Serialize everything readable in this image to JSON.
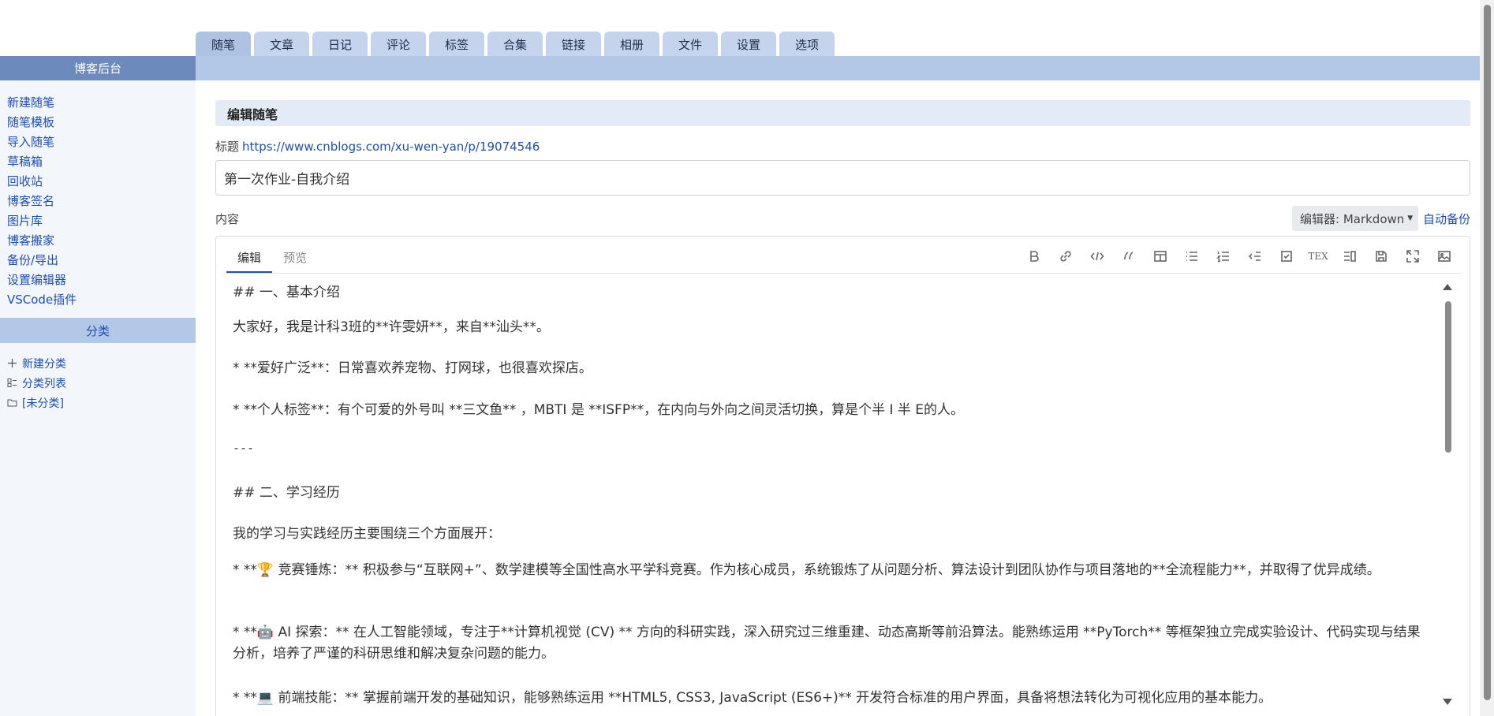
{
  "top_tabs": [
    "随笔",
    "文章",
    "日记",
    "评论",
    "标签",
    "合集",
    "链接",
    "相册",
    "文件",
    "设置",
    "选项"
  ],
  "sidebar": {
    "header": "博客后台",
    "links": [
      "新建随笔",
      "随笔模板",
      "导入随笔",
      "草稿箱",
      "回收站",
      "博客签名",
      "图片库",
      "博客搬家",
      "备份/导出",
      "设置编辑器",
      "VSCode插件"
    ],
    "category_header": "分类",
    "category_links": [
      {
        "icon": "plus-icon",
        "label": "新建分类"
      },
      {
        "icon": "list-icon",
        "label": "分类列表"
      },
      {
        "icon": "folder-icon",
        "label": "[未分类]"
      }
    ]
  },
  "main": {
    "section_title": "编辑随笔",
    "title_label": "标题",
    "title_link": "https://www.cnblogs.com/xu-wen-yan/p/19074546",
    "title_value": "第一次作业-自我介绍",
    "content_label": "内容",
    "editor_select": "编辑器: Markdown",
    "autosave": "自动备份"
  },
  "editor": {
    "tabs": [
      "编辑",
      "预览"
    ],
    "toolbar": [
      "bold-icon",
      "link-icon",
      "code-icon",
      "quote-icon",
      "table-icon",
      "bullet-list-icon",
      "numbered-list-icon",
      "outdent-icon",
      "checkbox-icon",
      "tex-icon",
      "side-by-side-icon",
      "save-icon",
      "fullscreen-icon",
      "image-icon"
    ],
    "tex_label": "TEX",
    "content": {
      "h1": "## 一、基本介绍",
      "intro": "大家好，我是计科3班的**许雯妍**，来自**汕头**。",
      "b1": "*   **爱好广泛**：日常喜欢养宠物、打网球，也很喜欢探店。",
      "b2": "*   **个人标签**：有个可爱的外号叫 **三文鱼** ，MBTI 是 **ISFP**，在内向与外向之间灵活切换，算是个半 I 半 E的人。",
      "hr": "---",
      "h2": "## 二、学习经历",
      "p2": "我的学习与实践经历主要围绕三个方面展开：",
      "b3": "*   **🏆 竞赛锤炼：** 积极参与“互联网+”、数学建模等全国性高水平学科竞赛。作为核心成员，系统锻炼了从问题分析、算法设计到团队协作与项目落地的**全流程能力**，并取得了优异成绩。",
      "b4": "*   **🤖 AI 探索：** 在人工智能领域，专注于**计算机视觉 (CV) ** 方向的科研实践，深入研究过三维重建、动态高斯等前沿算法。能熟练运用 **PyTorch** 等框架独立完成实验设计、代码实现与结果分析，培养了严谨的科研思维和解决复杂问题的能力。",
      "b5": "*   **💻 前端技能：** 掌握前端开发的基础知识，能够熟练运用 **HTML5, CSS3, JavaScript (ES6+)** 开发符合标准的用户界面，具备将想法转化为可视化应用的基本能力。"
    }
  }
}
